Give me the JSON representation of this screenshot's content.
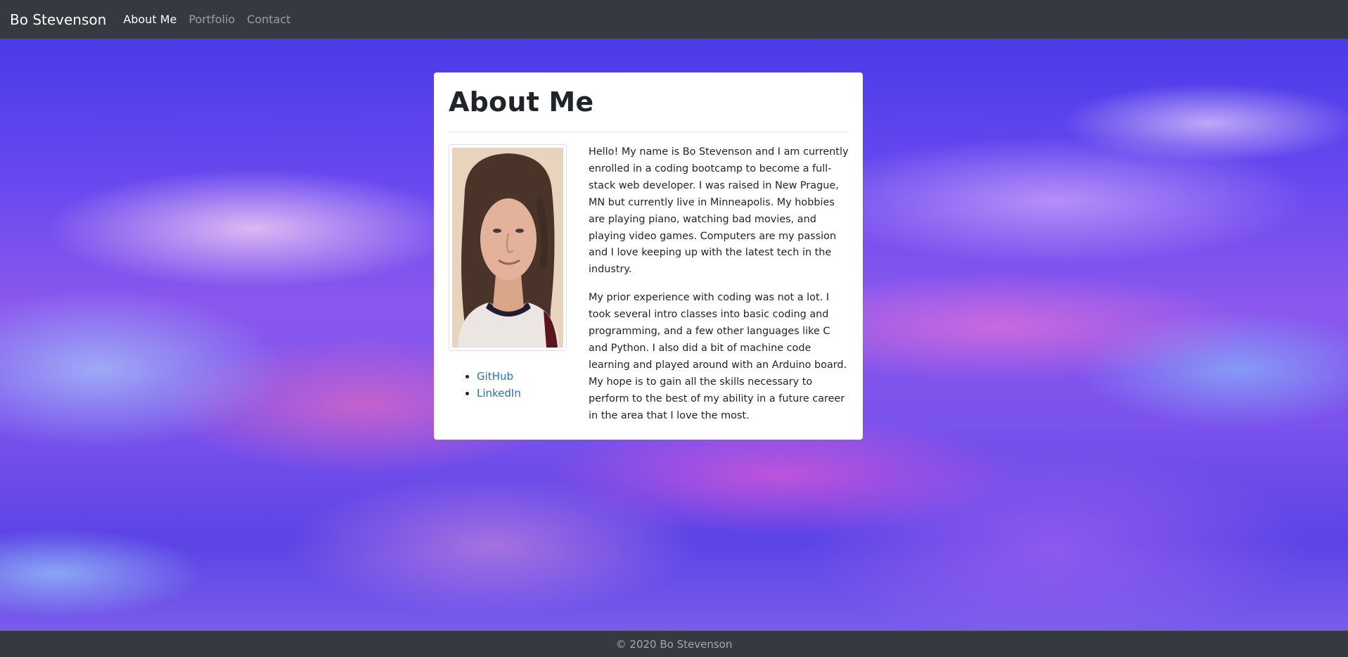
{
  "navbar": {
    "brand": "Bo Stevenson",
    "links": [
      {
        "label": "About Me",
        "active": true
      },
      {
        "label": "Portfolio",
        "active": false
      },
      {
        "label": "Contact",
        "active": false
      }
    ]
  },
  "main": {
    "title": "About Me",
    "links": [
      "GitHub",
      "LinkedIn"
    ],
    "paragraphs": [
      "Hello! My name is Bo Stevenson and I am currently enrolled in a coding bootcamp to become a full-stack web developer. I was raised in New Prague, MN but currently live in Minneapolis. My hobbies are playing piano, watching bad movies, and playing video games. Computers are my passion and I love keeping up with the latest tech in the industry.",
      "My prior experience with coding was not a lot. I took several intro classes into basic coding and programming, and a few other languages like C and Python. I also did a bit of machine code learning and played around with an Arduino board. My hope is to gain all the skills necessary to perform to the best of my ability in a future career in the area that I love the most."
    ]
  },
  "footer": {
    "text": "© 2020 Bo Stevenson"
  },
  "colors": {
    "navbar": "#343a40",
    "link": "#2a70b8",
    "text": "#212529"
  }
}
